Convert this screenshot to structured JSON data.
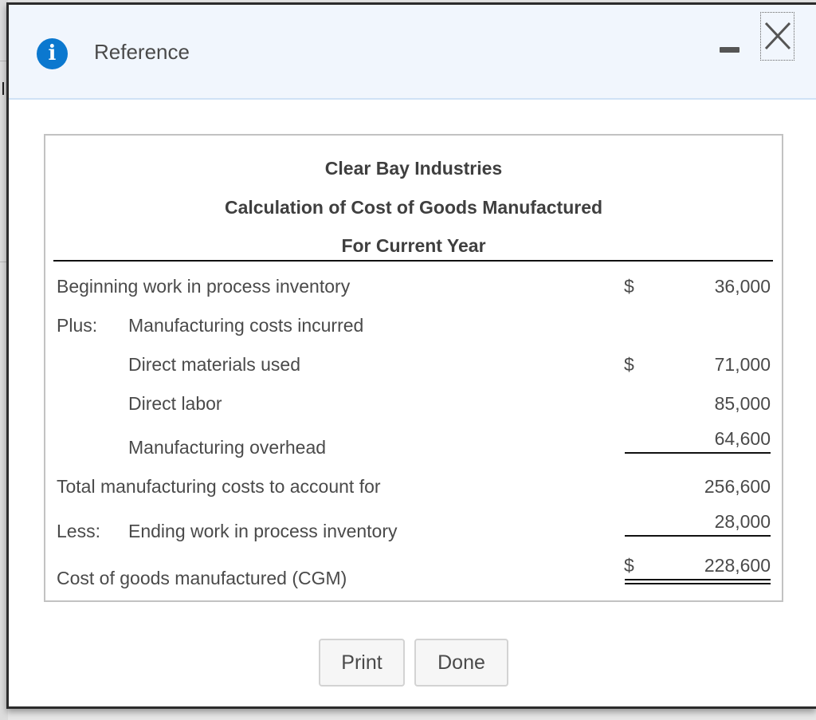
{
  "dialog": {
    "title": "Reference",
    "icon": "info-icon",
    "icon_glyph": "i",
    "minimize_icon": "minimize-icon",
    "close_icon": "close-icon"
  },
  "report": {
    "company": "Clear Bay Industries",
    "statement": "Calculation of Cost of Goods Manufactured",
    "period": "For Current Year",
    "currency_symbol": "$",
    "rows": [
      {
        "prefix": "",
        "label": "Beginning work in process inventory",
        "dollar": "$",
        "value": "36,000"
      },
      {
        "prefix": "Plus:",
        "label": "Manufacturing costs incurred",
        "dollar": "",
        "value": ""
      },
      {
        "prefix": "",
        "label": "Direct materials used",
        "dollar": "$",
        "value": "71,000"
      },
      {
        "prefix": "",
        "label": "Direct labor",
        "dollar": "",
        "value": "85,000"
      },
      {
        "prefix": "",
        "label": "Manufacturing overhead",
        "dollar": "",
        "value": "64,600"
      },
      {
        "prefix": "",
        "label": "Total manufacturing costs to account for",
        "dollar": "",
        "value": "256,600"
      },
      {
        "prefix": "Less:",
        "label": "Ending work in process inventory",
        "dollar": "",
        "value": "28,000"
      },
      {
        "prefix": "",
        "label": "Cost of goods manufactured (CGM)",
        "dollar": "$",
        "value": "228,600"
      }
    ]
  },
  "buttons": {
    "print": "Print",
    "done": "Done"
  },
  "colors": {
    "info_icon": "#0b78cf",
    "header_bg": "#f1f6fd"
  }
}
